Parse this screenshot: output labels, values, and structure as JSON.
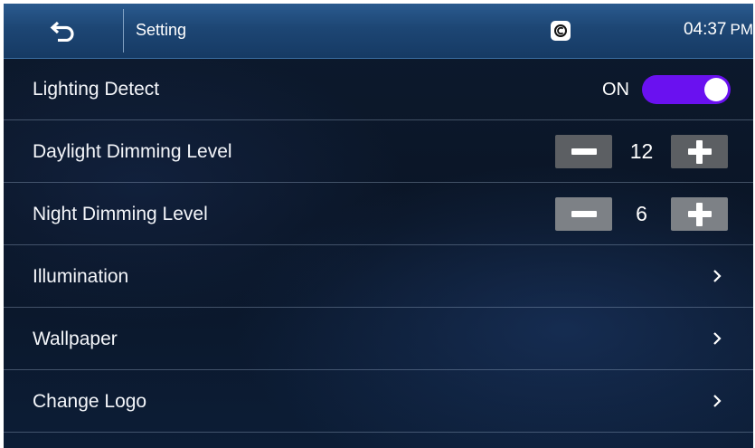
{
  "status_bar": {
    "title": "Setting",
    "time": "04:37",
    "ampm": "PM",
    "icons": {
      "back": "back-arrow-icon",
      "carplay": "carplay-icon"
    }
  },
  "settings": {
    "lighting_detect": {
      "label": "Lighting Detect",
      "state": "ON",
      "toggle_color": "#6a11f0"
    },
    "daylight_dimming": {
      "label": "Daylight Dimming Level",
      "value": "12"
    },
    "night_dimming": {
      "label": "Night Dimming Level",
      "value": "6"
    },
    "illumination": {
      "label": "Illumination"
    },
    "wallpaper": {
      "label": "Wallpaper"
    },
    "change_logo": {
      "label": "Change Logo"
    }
  }
}
